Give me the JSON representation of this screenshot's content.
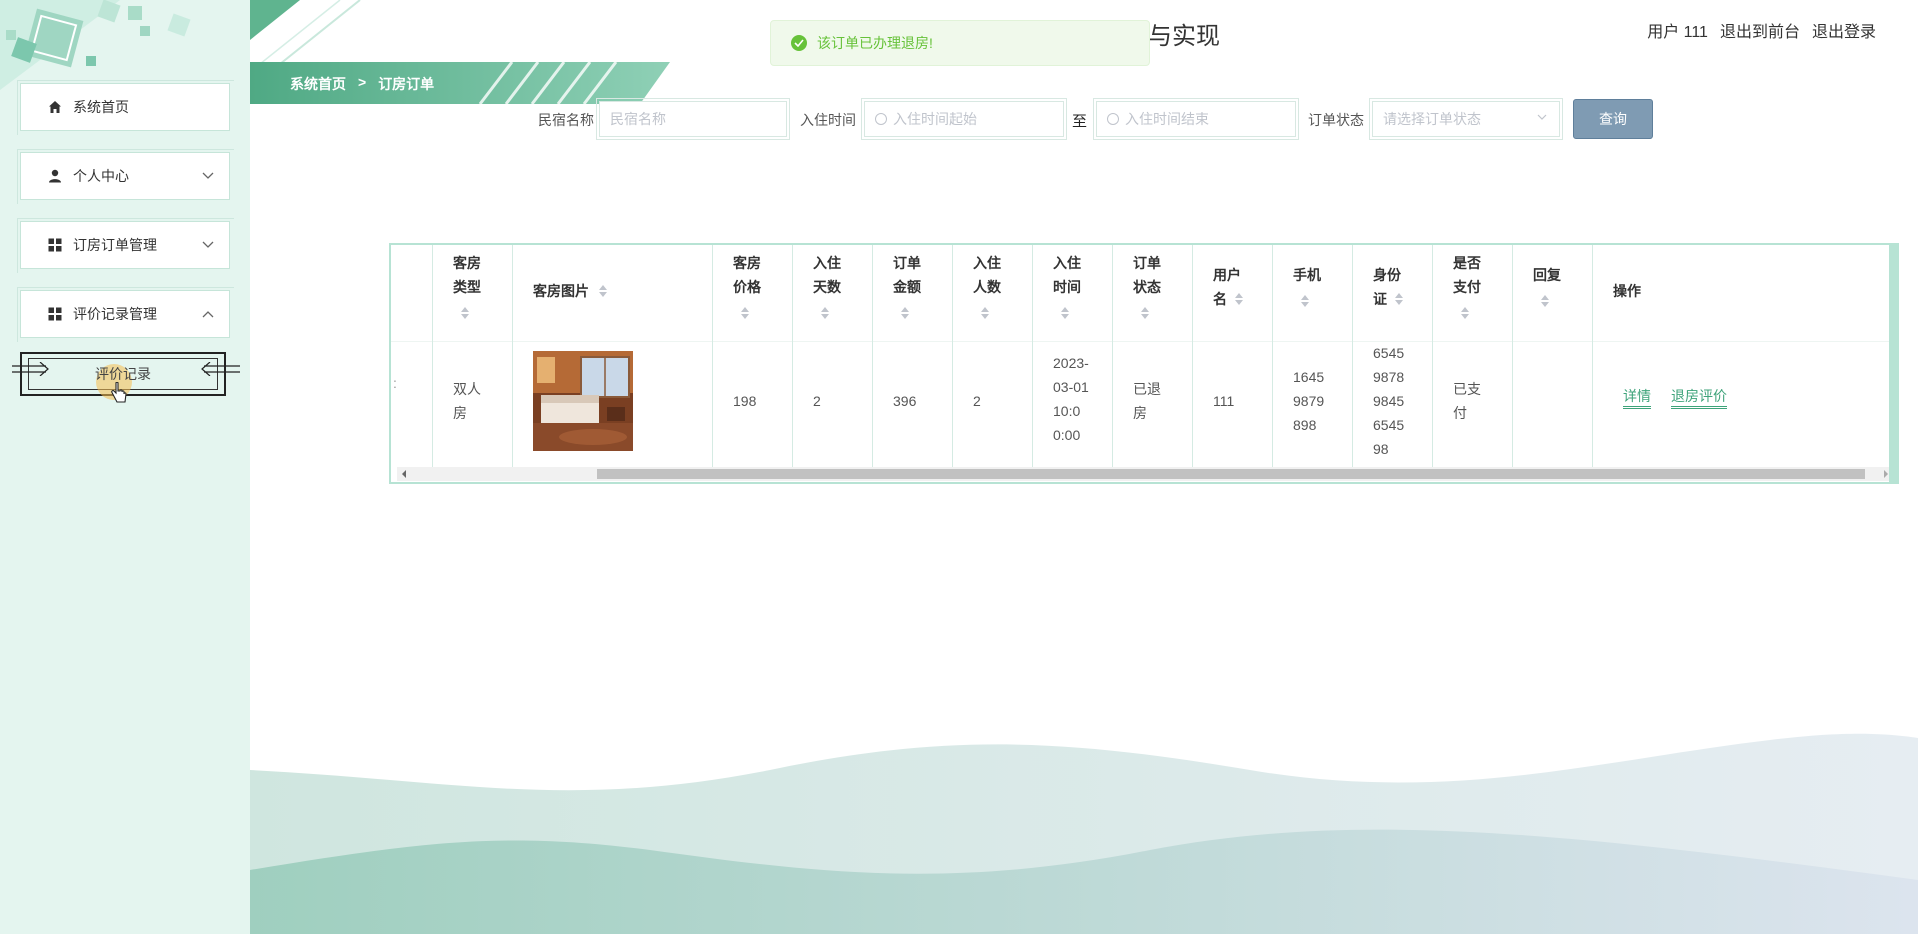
{
  "header": {
    "site_title_fragment": "与实现",
    "user_label": "用户 111",
    "back_to_front": "退出到前台",
    "logout": "退出登录"
  },
  "toast": {
    "message": "该订单已办理退房!"
  },
  "breadcrumb": {
    "home": "系统首页",
    "separator": ">",
    "current": "订房订单"
  },
  "sidebar": {
    "items": [
      {
        "label": "系统首页",
        "icon": "home-icon"
      },
      {
        "label": "个人中心",
        "icon": "user-icon",
        "chevron": "chevron-down-icon"
      },
      {
        "label": "订房订单管理",
        "icon": "grid-icon",
        "chevron": "chevron-down-icon"
      },
      {
        "label": "评价记录管理",
        "icon": "grid-icon",
        "chevron": "chevron-up-icon"
      }
    ],
    "sub_item": {
      "label": "评价记录"
    }
  },
  "search": {
    "homestay_label": "民宿名称",
    "homestay_placeholder": "民宿名称",
    "checkin_label": "入住时间",
    "checkin_start_placeholder": "入住时间起始",
    "range_sep": "至",
    "checkin_end_placeholder": "入住时间结束",
    "status_label": "订单状态",
    "status_placeholder": "请选择订单状态",
    "query_button": "查询"
  },
  "table": {
    "headers": {
      "room_type": [
        "客房",
        "类型"
      ],
      "room_image": "客房图片",
      "room_price": [
        "客房",
        "价格"
      ],
      "days": [
        "入住",
        "天数"
      ],
      "amount": [
        "订单",
        "金额"
      ],
      "guests": [
        "入住",
        "人数"
      ],
      "checkin_time": [
        "入住",
        "时间"
      ],
      "order_status": [
        "订单",
        "状态"
      ],
      "username": [
        "用户",
        "名"
      ],
      "phone": "手机",
      "id_card": [
        "身份",
        "证"
      ],
      "paid": [
        "是否",
        "支付"
      ],
      "reply": "回复",
      "actions": "操作"
    },
    "row": {
      "room_type": [
        "双人",
        "房"
      ],
      "room_price": "198",
      "days": "2",
      "amount": "396",
      "guests": "2",
      "checkin_time": [
        "2023-",
        "03-01",
        "10:0",
        "0:00"
      ],
      "order_status": [
        "已退",
        "房"
      ],
      "username": "111",
      "phone": [
        "1645",
        "9879",
        "898"
      ],
      "id_card": [
        "6545",
        "9878",
        "9845",
        "6545",
        "98"
      ],
      "paid": [
        "已支",
        "付"
      ],
      "reply": "",
      "detail_link": "详情",
      "review_link": "退房评价"
    }
  },
  "colors": {
    "accent": "#3ea37a",
    "sidebar_bg": "#e4f5ef",
    "table_border": "#b7e3d4",
    "toast_text": "#67c23a",
    "query_btn": "#7f9bb3"
  }
}
